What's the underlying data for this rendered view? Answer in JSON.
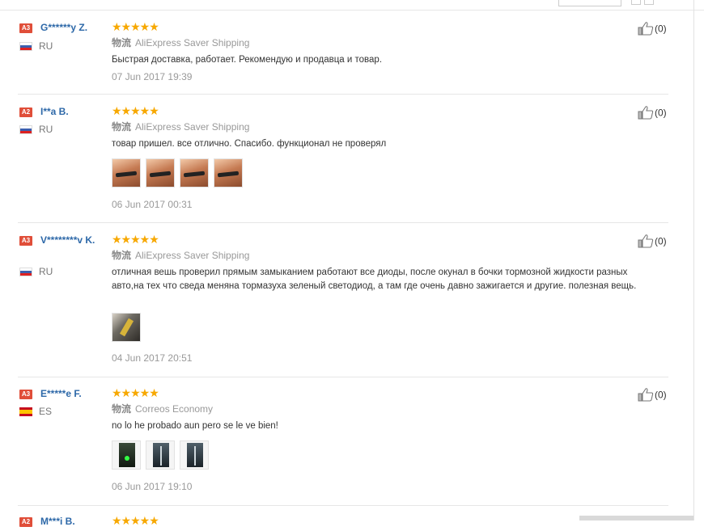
{
  "reviews": [
    {
      "level": "A3",
      "name": "G******y Z.",
      "country": "RU",
      "flag": "ru",
      "stars": "★★★★★",
      "shipping_label": "物流",
      "shipping": "AliExpress Saver Shipping",
      "text": "Быстрая доставка, работает. Рекомендую и продавца и товар.",
      "date": "07 Jun 2017 19:39",
      "likes": "(0)",
      "photos": []
    },
    {
      "level": "A2",
      "name": "I**a B.",
      "country": "RU",
      "flag": "ru",
      "stars": "★★★★★",
      "shipping_label": "物流",
      "shipping": "AliExpress Saver Shipping",
      "text": "товар пришел. все отлично. Спасибо. функционал не проверял",
      "date": "06 Jun 2017 00:31",
      "likes": "(0)",
      "photos": [
        "a",
        "a",
        "a",
        "a"
      ]
    },
    {
      "level": "A3",
      "name": "V********v K.",
      "country": "RU",
      "flag": "ru",
      "stars": "★★★★★",
      "shipping_label": "物流",
      "shipping": "AliExpress Saver Shipping",
      "text": "отличная вешь проверил прямым замыканием работают все диоды, после окунал в бочки тормозной жидкости разных авто,на тех что сведа меняна тормазуха зеленый светодиод, а там где очень давно зажигается и другие. полезная вещь.",
      "date": "04 Jun 2017 20:51",
      "likes": "(0)",
      "photos": [
        "b"
      ]
    },
    {
      "level": "A3",
      "name": "E*****e F.",
      "country": "ES",
      "flag": "es",
      "stars": "★★★★★",
      "shipping_label": "物流",
      "shipping": "Correos Economy",
      "text": "no lo he probado aun pero se le ve bien!",
      "date": "06 Jun 2017 19:10",
      "likes": "(0)",
      "photos": [
        "c",
        "d",
        "d"
      ]
    },
    {
      "level": "A2",
      "name": "M***i B.",
      "stars": "★★★★★"
    }
  ]
}
